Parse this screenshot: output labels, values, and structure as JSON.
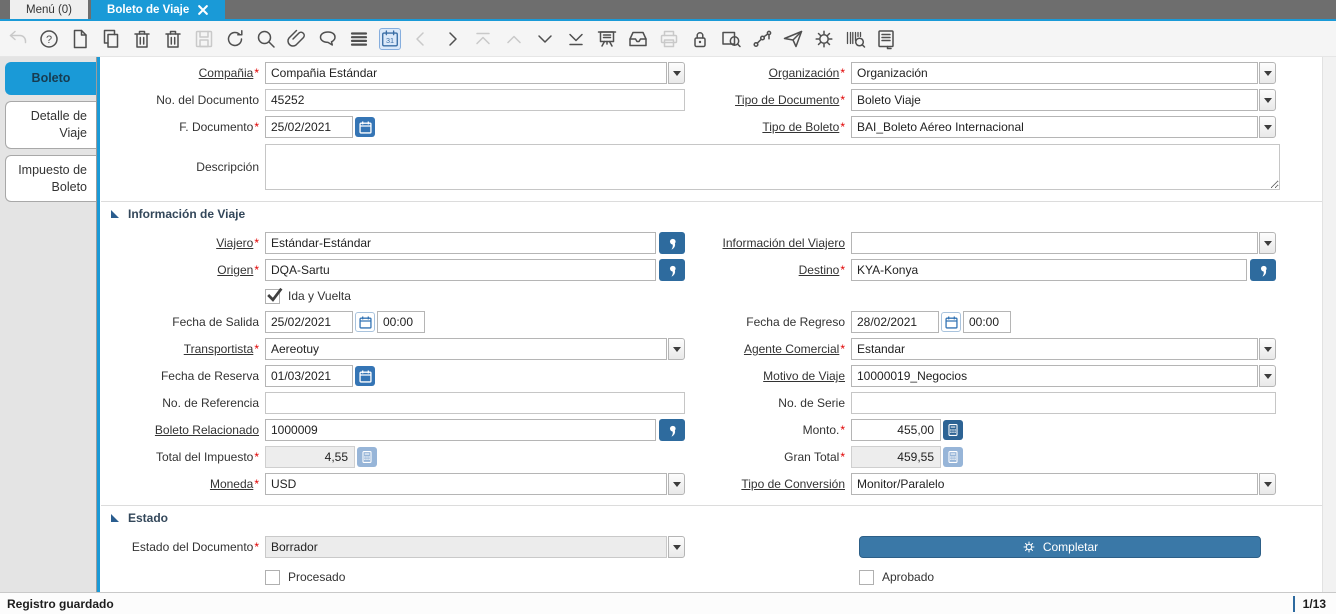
{
  "tabbar": {
    "tabs": [
      {
        "label": "Menú (0)",
        "active": false
      },
      {
        "label": "Boleto de Viaje",
        "active": true,
        "closable": true
      }
    ]
  },
  "toolbar": {
    "icons": [
      {
        "name": "undo-icon",
        "state": "disabled"
      },
      {
        "name": "help-icon",
        "state": "enabled"
      },
      {
        "name": "new-record-icon",
        "state": "enabled"
      },
      {
        "name": "copy-record-icon",
        "state": "enabled"
      },
      {
        "name": "delete-record-icon",
        "state": "enabled"
      },
      {
        "name": "delete-selection-icon",
        "state": "enabled"
      },
      {
        "name": "save-icon",
        "state": "disabled"
      },
      {
        "name": "refresh-icon",
        "state": "enabled"
      },
      {
        "name": "find-icon",
        "state": "enabled"
      },
      {
        "name": "attachment-icon",
        "state": "enabled"
      },
      {
        "name": "chat-icon",
        "state": "enabled"
      },
      {
        "name": "grid-toggle-icon",
        "state": "enabled"
      },
      {
        "name": "calendar-month-icon",
        "state": "active"
      },
      {
        "name": "prev-record-icon",
        "state": "disabled"
      },
      {
        "name": "next-record-icon",
        "state": "enabled"
      },
      {
        "name": "parent-record-icon",
        "state": "disabled"
      },
      {
        "name": "up-record-icon",
        "state": "disabled"
      },
      {
        "name": "down-record-icon",
        "state": "enabled"
      },
      {
        "name": "detail-record-icon",
        "state": "enabled"
      },
      {
        "name": "report-icon",
        "state": "enabled"
      },
      {
        "name": "archive-icon",
        "state": "enabled"
      },
      {
        "name": "print-icon",
        "state": "disabled"
      },
      {
        "name": "lock-icon",
        "state": "enabled"
      },
      {
        "name": "zoom-across-icon",
        "state": "enabled"
      },
      {
        "name": "workflow-icon",
        "state": "enabled"
      },
      {
        "name": "send-icon",
        "state": "enabled"
      },
      {
        "name": "process-icon",
        "state": "enabled"
      },
      {
        "name": "barcode-reader-icon",
        "state": "enabled"
      },
      {
        "name": "report-window-icon",
        "state": "enabled"
      }
    ]
  },
  "sidebar": {
    "tabs": [
      {
        "label": "Boleto",
        "active": true
      },
      {
        "label": "Detalle de Viaje",
        "active": false
      },
      {
        "label": "Impuesto de Boleto",
        "active": false
      }
    ]
  },
  "form": {
    "sections": [
      {
        "title": "Información de Viaje"
      },
      {
        "title": "Estado"
      }
    ],
    "fields": {
      "compania": {
        "label": "Compañia",
        "value": "Compañia Estándar"
      },
      "organizacion": {
        "label": "Organización",
        "value": "Organización"
      },
      "no_documento": {
        "label": "No. del Documento",
        "value": "45252"
      },
      "tipo_documento": {
        "label": "Tipo de Documento",
        "value": "Boleto Viaje"
      },
      "f_documento": {
        "label": "F. Documento",
        "value": "25/02/2021"
      },
      "tipo_boleto": {
        "label": "Tipo de Boleto",
        "value": "BAI_Boleto Aéreo Internacional"
      },
      "descripcion": {
        "label": "Descripción",
        "value": ""
      },
      "viajero": {
        "label": "Viajero",
        "value": "Estándar-Estándar"
      },
      "info_viajero": {
        "label": "Información del Viajero",
        "value": ""
      },
      "origen": {
        "label": "Origen",
        "value": "DQA-Sartu"
      },
      "destino": {
        "label": "Destino",
        "value": "KYA-Konya"
      },
      "ida_vuelta": {
        "label": "Ida y Vuelta",
        "checked": true
      },
      "fecha_salida": {
        "label": "Fecha de Salida",
        "value": "25/02/2021",
        "time": "00:00"
      },
      "fecha_regreso": {
        "label": "Fecha de Regreso",
        "value": "28/02/2021",
        "time": "00:00"
      },
      "transportista": {
        "label": "Transportista",
        "value": "Aereotuy"
      },
      "agente_comercial": {
        "label": "Agente Comercial",
        "value": "Estandar"
      },
      "fecha_reserva": {
        "label": "Fecha de Reserva",
        "value": "01/03/2021"
      },
      "motivo_viaje": {
        "label": "Motivo de Viaje",
        "value": "10000019_Negocios"
      },
      "no_referencia": {
        "label": "No. de Referencia",
        "value": ""
      },
      "no_serie": {
        "label": "No. de Serie",
        "value": ""
      },
      "boleto_relacionado": {
        "label": "Boleto Relacionado",
        "value": "1000009"
      },
      "monto": {
        "label": "Monto.",
        "value": "455,00"
      },
      "total_impuesto": {
        "label": "Total del Impuesto",
        "value": "4,55"
      },
      "gran_total": {
        "label": "Gran Total",
        "value": "459,55"
      },
      "moneda": {
        "label": "Moneda",
        "value": "USD"
      },
      "tipo_conversion": {
        "label": "Tipo de Conversión",
        "value": "Monitor/Paralelo"
      },
      "estado_documento": {
        "label": "Estado del Documento",
        "value": "Borrador"
      },
      "procesado": {
        "label": "Procesado",
        "checked": false
      },
      "aprobado": {
        "label": "Aprobado",
        "checked": false
      }
    },
    "actions": {
      "completar": "Completar"
    }
  },
  "statusbar": {
    "message": "Registro guardado",
    "record": "1/13"
  },
  "colors": {
    "accent": "#1a9ad7",
    "lookup_button": "#2e6b9e",
    "calendar_button": "#3575b5",
    "completar_button": "#3a78a7",
    "required_marker": "#e00000"
  }
}
